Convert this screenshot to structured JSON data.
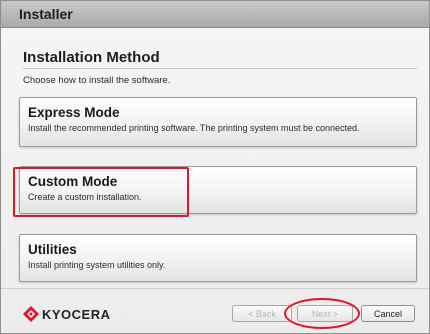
{
  "window": {
    "title": "Installer"
  },
  "page": {
    "heading": "Installation Method",
    "instruction": "Choose how to install the software."
  },
  "modes": [
    {
      "title": "Express Mode",
      "description": "Install the recommended printing software. The printing system must be connected."
    },
    {
      "title": "Custom Mode",
      "description": "Create a custom installation."
    },
    {
      "title": "Utilities",
      "description": "Install printing system utilities only."
    }
  ],
  "footer": {
    "logo_text": "KYOCERA",
    "back_label": "< Back",
    "next_label": "Next >",
    "cancel_label": "Cancel"
  },
  "colors": {
    "highlight": "#e0142a",
    "logo_red": "#e0142a"
  }
}
